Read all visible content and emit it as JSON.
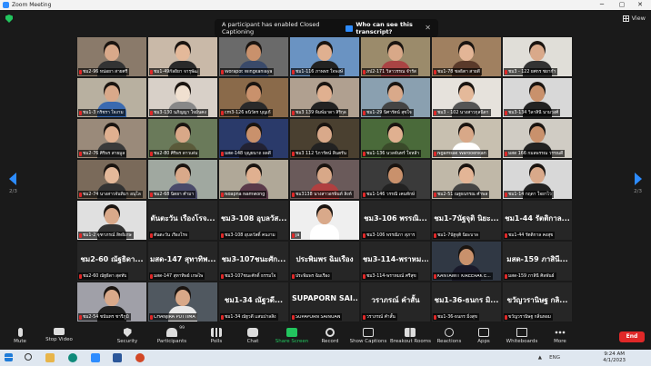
{
  "window": {
    "title": "Zoom Meeting",
    "minimize": "─",
    "maximize": "▢",
    "close": "✕"
  },
  "view_button": {
    "label": "View"
  },
  "notification": {
    "text": "A participant has enabled Closed Captioning",
    "link": "Who can see this transcript?",
    "close": "✕"
  },
  "pages": {
    "left": "2/3",
    "right": "2/3"
  },
  "tiles": [
    {
      "name": "ชม2-96 หน่อยา สายศรี",
      "kind": "video",
      "bg": "#8a7a6a",
      "skin": "#d9a98a",
      "shirt": "#333"
    },
    {
      "name": "ชม1-49กัลยิยา จารุพัฒ",
      "kind": "video",
      "bg": "#c9b9a8",
      "skin": "#e4b99a",
      "shirt": "#2a2a2a"
    },
    {
      "name": "Worapot Wingkanlaya",
      "kind": "video",
      "bg": "#6a6a6a",
      "skin": "#c9916c",
      "shirt": "#3a4a6a"
    },
    {
      "name": "ชม1-116 ภาพพร ใจพงษ์",
      "kind": "video",
      "bg": "#6a93c2",
      "skin": "#e0b090",
      "shirt": "#222"
    },
    {
      "name": "ภป2-171 วิลาวรรณ จำรัส",
      "kind": "video",
      "bg": "#9b8b6b",
      "skin": "#d8a888",
      "shirt": "#aa4444"
    },
    {
      "name": "ชม1-78 ชลธิตา สายดี",
      "kind": "video",
      "bg": "#a08060",
      "skin": "#e3b596",
      "shirt": "#5a3a2a"
    },
    {
      "name": "ชม3 - 122 ยศกร ชยากำ",
      "kind": "video",
      "bg": "#e0ded8",
      "skin": "#d9a98a",
      "shirt": "#333"
    },
    {
      "name": "ชม1-3 กริชรา ใจงาม",
      "kind": "video",
      "bg": "#b8b0a0",
      "skin": "#d9a98a",
      "shirt": "#3a6ab0"
    },
    {
      "name": "ชม3-130 นภิญญา ใจมั่นคง",
      "kind": "video",
      "bg": "#d8d0c8",
      "skin": "#f0e0d0",
      "shirt": "#888"
    },
    {
      "name": "cm3-126 ธนิวัตร บุญเก้",
      "kind": "video",
      "bg": "#8a6a4a",
      "skin": "#c9916c",
      "shirt": "#2a2a2a"
    },
    {
      "name": "ชม3 139 พิมพ์มาดา สิริกุล",
      "kind": "video",
      "bg": "#b0a090",
      "skin": "#e0b090",
      "shirt": "#222"
    },
    {
      "name": "ชม1-29 นิศารัตน์ สุขใจ",
      "kind": "video",
      "bg": "#8aa0b0",
      "skin": "#d9a98a",
      "shirt": "#444"
    },
    {
      "name": "ชม3 - 102 นางสาวกุลนิดา",
      "kind": "video",
      "bg": "#e6e2dc",
      "skin": "#e4b99a",
      "shirt": "#555"
    },
    {
      "name": "ชม3-134 วิลาสินี นามวงศ์",
      "kind": "video",
      "bg": "#d8d8d8",
      "skin": "#c9916c",
      "shirt": "#222"
    },
    {
      "name": "ชม2-76 ศิริพร สายมูล",
      "kind": "video",
      "bg": "#9a8a7a",
      "skin": "#e0b090",
      "shirt": "#3a3a3a"
    },
    {
      "name": "ชม2-80 ศิริพร ดาวเด่น",
      "kind": "video",
      "bg": "#6a7a5a",
      "skin": "#d8a888",
      "shirt": "#5a5a3a"
    },
    {
      "name": "มสด-148 บุญยนาถ ผลดี",
      "kind": "video",
      "bg": "#2a3a6a",
      "skin": "#c9916c",
      "shirt": "#223"
    },
    {
      "name": "ชม3 112 วิภารัตน์ ลีนตรัน",
      "kind": "video",
      "bg": "#4a4030",
      "skin": "#d9a98a",
      "shirt": "#222"
    },
    {
      "name": "ชม1-136 นวลจันทร์ ใจหล้า",
      "kind": "video",
      "bg": "#4a6a3a",
      "skin": "#e0b090",
      "shirt": "#3a4a2a"
    },
    {
      "name": "Ngamsak Warooehkan",
      "kind": "video",
      "bg": "#c8c0b0",
      "skin": "#d8a888",
      "shirt": "#fff"
    },
    {
      "name": "มสด 166 กมลพรรณ วรรณดี",
      "kind": "video",
      "bg": "#d0ccc4",
      "skin": "#c9916c",
      "shirt": "#222"
    },
    {
      "name": "ชม2-74 นางสาวจันทิมา อนุโล",
      "kind": "video",
      "bg": "#7a6a5a",
      "skin": "#e4b99a",
      "shirt": "#333"
    },
    {
      "name": "ชม2-68 นิตยา คำมา",
      "kind": "video",
      "bg": "#a0a8a0",
      "skin": "#d9a98a",
      "shirt": "#4a4a6a"
    },
    {
      "name": "Ndapha Namwong",
      "kind": "video",
      "bg": "#b0a898",
      "skin": "#e0b090",
      "shirt": "#5a3a4a"
    },
    {
      "name": "ชม3138 นางสาวอรพินท์ สิงห์",
      "kind": "video",
      "bg": "#6a5a5a",
      "skin": "#d8a888",
      "shirt": "#b04040"
    },
    {
      "name": "ชม1-146 วรรณี เคนทักษ์",
      "kind": "video",
      "bg": "#3a3a3a",
      "skin": "#c9916c",
      "shirt": "#222"
    },
    {
      "name": "ชม2-51 ณฐธนรรณ คำพล",
      "kind": "video",
      "bg": "#c0b8a8",
      "skin": "#e3b596",
      "shirt": "#444"
    },
    {
      "name": "ชม1-14 กฤตา ใจยาไว",
      "kind": "video",
      "bg": "#d8d8d8",
      "skin": "#d9a98a",
      "shirt": "#222"
    },
    {
      "name": "ชม1-2 จุฑาภรณ์ สิทธิเกษ",
      "kind": "video",
      "bg": "#e0e0e0",
      "skin": "#d9a98a",
      "shirt": "#333"
    },
    {
      "name": "ตันตะวัน เรืองโรจ",
      "kind": "name",
      "big": "ตันตะวัน เรืองโรจ..."
    },
    {
      "name": "ชม3-108 อุบลวัสดิ์ คนงาม",
      "kind": "name",
      "big": "ชม3-108 อุบลวัส..."
    },
    {
      "name": "Ja",
      "kind": "video",
      "bg": "#efefef",
      "skin": "#d9a98a",
      "shirt": "#fff"
    },
    {
      "name": "ชม3-106 พรรณิภา สุภาร",
      "kind": "name",
      "big": "ชม3-106 พรรณิ..."
    },
    {
      "name": "ชม1-7นัฐจุติ นิยะบาล",
      "kind": "name",
      "big": "ชม1-7นัฐจุติ นิยะ..."
    },
    {
      "name": "ชม1-44 รัตติกาล คงสุข",
      "kind": "name",
      "big": "ชม1-44 รัตติกาล..."
    },
    {
      "name": "ชม2-60 ณัฐธิดา สุดทับ",
      "kind": "name",
      "big": "ชม2-60 ณัฐธิดา..."
    },
    {
      "name": "มสด-147 สุทาทิพย์ เกษไพ",
      "kind": "name",
      "big": "มสด-147 สุทาทิพ..."
    },
    {
      "name": "ชม3-107ชนะศักดิ์ ธรรมใจ",
      "kind": "name",
      "big": "ชม3-107ชนะศัก..."
    },
    {
      "name": "ประพิมพร ฉิมเรือง",
      "kind": "name",
      "big": "ประพิมพร ฉิมเรือง"
    },
    {
      "name": "ชม3-114-พราหมณ์ ศรีสุข",
      "kind": "name",
      "big": "ชม3-114-พราหม..."
    },
    {
      "name": "KANTAWIT KIREERAK E...",
      "kind": "video",
      "bg": "#303844",
      "skin": "#c9916c",
      "shirt": "#1a1a2a"
    },
    {
      "name": "มสด-159 ภาสินี ศิลพันธ์",
      "kind": "name",
      "big": "มสด-159 ภาสินี..."
    },
    {
      "name": "ชม2-54 ชนันทร ชารีภูมิ",
      "kind": "video",
      "bg": "#a0a0a8",
      "skin": "#d9a98a",
      "shirt": "#222"
    },
    {
      "name": "CHANJIRA PUTTIMA",
      "kind": "video",
      "bg": "#505860",
      "skin": "#d8a888",
      "shirt": "#e8e8e8"
    },
    {
      "name": "ชม1-34 ณัฐวดี แสนปาลสิง",
      "kind": "name",
      "big": "ชม1-34 ณัฐวดี..."
    },
    {
      "name": "SUPAPORN SAINUAN",
      "kind": "name",
      "big": "SUPAPORN SAI..."
    },
    {
      "name": "วราภรณ์ คำสั้น",
      "kind": "name",
      "big": "วราภรณ์ คำสั้น"
    },
    {
      "name": "ชม1-36-ธนกร มิ่งสุข",
      "kind": "name",
      "big": "ชม1-36-ธนกร มิ..."
    },
    {
      "name": "ขวัญวรานิษฐ กลิ่นหอม",
      "kind": "name",
      "big": "ขวัญวรานิษฐ กลิ..."
    }
  ],
  "toolbar": {
    "mute": "Mute",
    "stop_video": "Stop Video",
    "security": "Security",
    "participants": "Participants",
    "participants_count": "99",
    "polls": "Polls",
    "chat": "Chat",
    "share": "Share Screen",
    "record": "Record",
    "captions": "Show Captions",
    "breakout": "Breakout Rooms",
    "reactions": "Reactions",
    "apps": "Apps",
    "whiteboards": "Whiteboards",
    "more": "More",
    "end": "End"
  },
  "taskbar": {
    "time": "9:24 AM",
    "date": "4/1/2023",
    "lang": "ENG",
    "notif": "▲"
  }
}
